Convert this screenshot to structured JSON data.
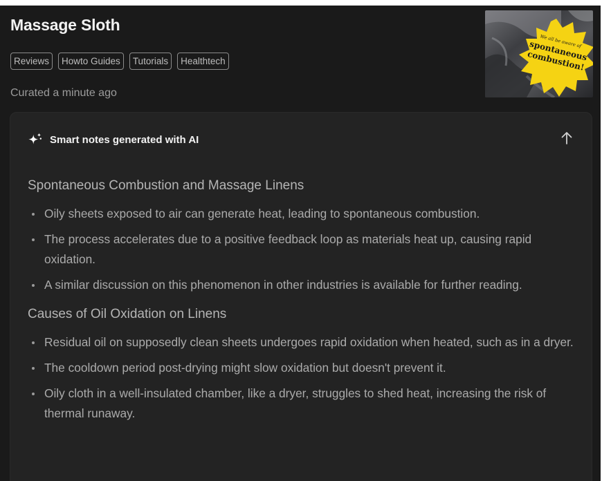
{
  "page": {
    "title": "Massage Sloth",
    "tags": [
      "Reviews",
      "Howto Guides",
      "Tutorials",
      "Healthtech"
    ],
    "curated": "Curated a minute ago"
  },
  "thumbnail": {
    "badge_lines": [
      "We all be aware of",
      "spontaneous",
      "combustion!"
    ],
    "badge_color": "#f5d313"
  },
  "notes": {
    "header": "Smart notes generated with AI",
    "header_icon": "sparkle-icon",
    "collapse_icon": "arrow-up-icon",
    "sections": [
      {
        "heading": "Spontaneous Combustion and Massage Linens",
        "bullets": [
          "Oily sheets exposed to air can generate heat, leading to spontaneous combustion.",
          "The process accelerates due to a positive feedback loop as materials heat up, causing rapid oxidation.",
          "A similar discussion on this phenomenon in other industries is available for further reading."
        ]
      },
      {
        "heading": "Causes of Oil Oxidation on Linens",
        "bullets": [
          "Residual oil on supposedly clean sheets undergoes rapid oxidation when heated, such as in a dryer.",
          "The cooldown period post-drying might slow oxidation but doesn't prevent it.",
          "Oily cloth in a well-insulated chamber, like a dryer, struggles to shed heat, increasing the risk of thermal runaway."
        ]
      }
    ]
  },
  "colors": {
    "background": "#1a1a1a",
    "card": "#232323",
    "text_primary": "#f2f2f2",
    "text_secondary": "#ababab"
  }
}
